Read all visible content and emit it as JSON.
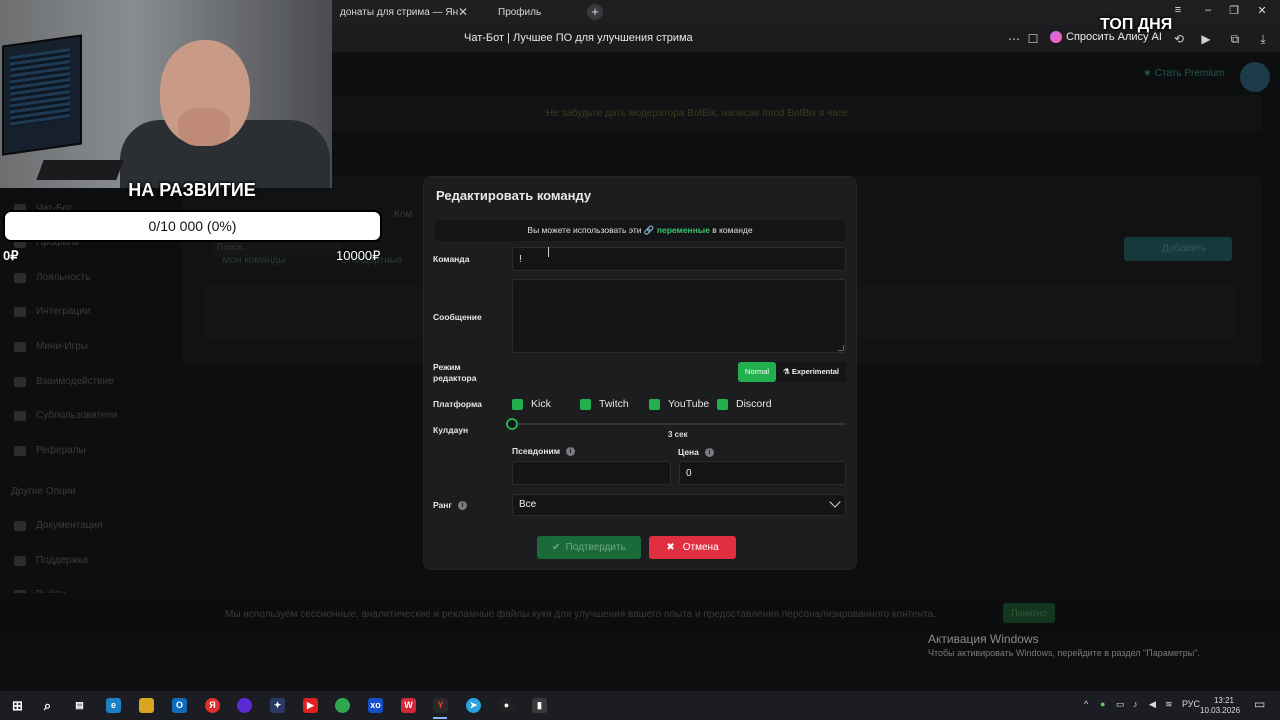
{
  "browser": {
    "tabs": [
      {
        "label": "донаты для стрима — Ян"
      },
      {
        "label": "Профиль"
      }
    ],
    "new_tab": "+",
    "address_title": "Чат-Бот | Лучшее ПО для улучшения стрима",
    "alice_label": "Спросить Алису AI",
    "window_controls": [
      "–",
      "❐",
      "✕"
    ]
  },
  "page": {
    "premium": "Стать Premium",
    "notice": "Не забудьте дать модератора BotBix, написав /mod BotBix в чате.",
    "sidebar": [
      "Чат-Бот",
      "Профиль",
      "Лояльность",
      "Интеграции",
      "Мини-Игры",
      "Взаимодействие",
      "Субпользователи",
      "Рефералы",
      "Другие Опции",
      "Документация",
      "Поддержка",
      "Выйти"
    ],
    "tabs": [
      "Мои команды",
      "Стандартные",
      "Ком"
    ],
    "search_placeholder": "Поиск...",
    "add_button": "Добавить",
    "cookie_text": "Мы используем сессионные, аналитические и рекламные файлы куки для улучшения вашего опыта и предоставления персонализированного контента.",
    "cookie_button": "Понятно"
  },
  "overlay": {
    "goal_title": "НА РАЗВИТИЕ",
    "goal_progress": "0/10 000 (0%)",
    "goal_progress_fraction": 0,
    "goal_min": "0₽",
    "goal_max": "10000₽",
    "top_day": "ТОП ДНЯ"
  },
  "modal": {
    "title": "Редактировать команду",
    "hint_prefix": "Вы можете использовать эти",
    "hint_link": "переменные",
    "hint_suffix": "в команде",
    "command_label": "Команда",
    "command_value": "!",
    "message_label": "Сообщение",
    "message_value": "",
    "editor_mode_label": "Режим редактора",
    "mode_normal": "Normal",
    "mode_experimental": "Experimental",
    "platform_label": "Платформа",
    "platforms": [
      "Kick",
      "Twitch",
      "YouTube",
      "Discord"
    ],
    "cooldown_label": "Кулдаун",
    "cooldown_value": "3 сек",
    "alias_label": "Псевдоним",
    "alias_value": "",
    "price_label": "Цена",
    "price_value": "0",
    "rank_label": "Ранг",
    "rank_value": "Все",
    "confirm_button": "Подтвердить",
    "cancel_button": "Отмена"
  },
  "watermark": {
    "title": "Активация Windows",
    "subtitle": "Чтобы активировать Windows, перейдите в раздел \"Параметры\"."
  },
  "taskbar": {
    "language": "РУС",
    "time": "13:21",
    "date": "10.03.2026"
  },
  "colors": {
    "accent_green": "#22b04c",
    "cancel_red": "#e0303f",
    "modal_bg": "#1c1d1f"
  }
}
